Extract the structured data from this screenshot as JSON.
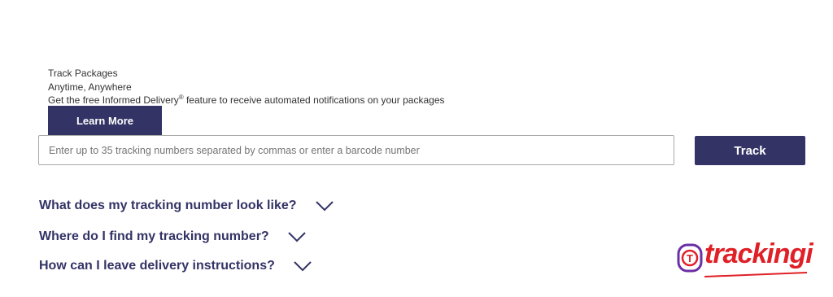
{
  "promo": {
    "line1": "Track Packages",
    "line2": "Anytime, Anywhere",
    "line3_prefix": "Get the free Informed Delivery",
    "line3_reg": "®",
    "line3_suffix": " feature to receive automated notifications on your packages",
    "learn_more_label": "Learn More"
  },
  "tracking": {
    "input_placeholder": "Enter up to 35 tracking numbers separated by commas or enter a barcode number",
    "input_value": "",
    "track_label": "Track"
  },
  "faq": [
    {
      "question": "What does my tracking number look like?",
      "icon": "chevron-down-icon"
    },
    {
      "question": "Where do I find my tracking number?",
      "icon": "chevron-down-icon"
    },
    {
      "question": "How can I leave delivery instructions?",
      "icon": "chevron-down-icon"
    }
  ],
  "watermark": {
    "logo_text": "trackingi",
    "logo_letter": "T"
  },
  "colors": {
    "primary": "#333366",
    "text": "#333333",
    "logo_red": "#e02027",
    "logo_purple": "#6b2fa6"
  }
}
